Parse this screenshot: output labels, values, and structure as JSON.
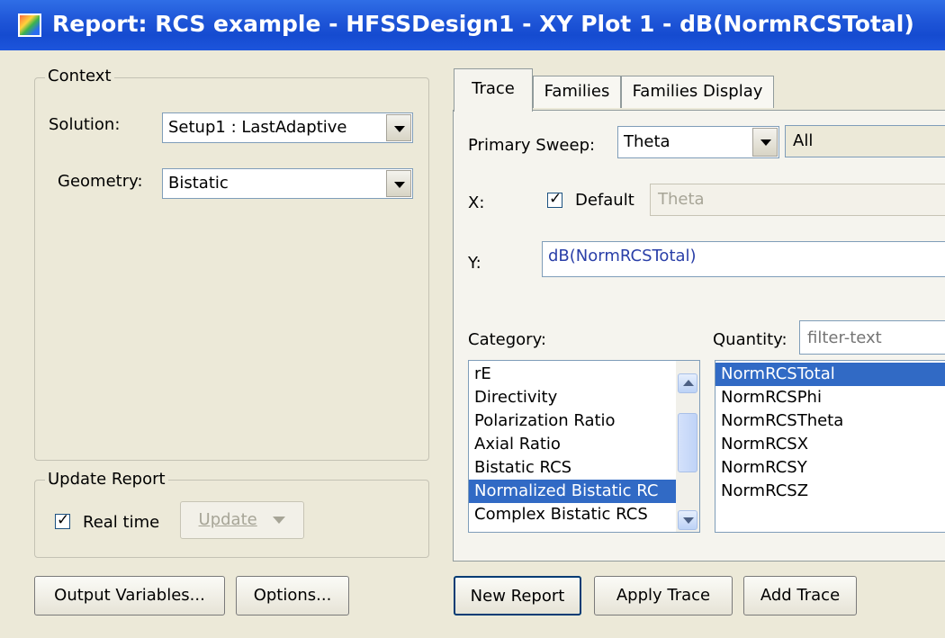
{
  "window": {
    "title": "Report: RCS example - HFSSDesign1 - XY Plot 1 - dB(NormRCSTotal)"
  },
  "context": {
    "group_label": "Context",
    "solution_label": "Solution:",
    "solution_value": "Setup1 : LastAdaptive",
    "geometry_label": "Geometry:",
    "geometry_value": "Bistatic"
  },
  "update_report": {
    "group_label": "Update Report",
    "realtime_label": "Real time",
    "realtime_checked": true,
    "update_button": "Update"
  },
  "tabs": [
    {
      "label": "Trace"
    },
    {
      "label": "Families"
    },
    {
      "label": "Families Display"
    }
  ],
  "trace": {
    "primary_sweep_label": "Primary Sweep:",
    "primary_sweep_value": "Theta",
    "primary_sweep_range": "All",
    "x_label": "X:",
    "x_default_label": "Default",
    "x_default_checked": true,
    "x_value": "Theta",
    "y_label": "Y:",
    "y_value": "dB(NormRCSTotal)",
    "category_label": "Category:",
    "quantity_label": "Quantity:",
    "quantity_filter_placeholder": "filter-text",
    "categories": [
      "rE",
      "Directivity",
      "Polarization Ratio",
      "Axial Ratio",
      "Bistatic RCS",
      "Normalized Bistatic RC",
      "Complex Bistatic RCS"
    ],
    "selected_category": "Normalized Bistatic RC",
    "quantities": [
      "NormRCSTotal",
      "NormRCSPhi",
      "NormRCSTheta",
      "NormRCSX",
      "NormRCSY",
      "NormRCSZ"
    ],
    "selected_quantity": "NormRCSTotal"
  },
  "buttons": {
    "output_variables": "Output Variables...",
    "options": "Options...",
    "new_report": "New Report",
    "apply_trace": "Apply Trace",
    "add_trace": "Add Trace"
  },
  "colors": {
    "title_bar": "#1f56d8",
    "selection": "#316ac5",
    "dialog_bg": "#ece9d8",
    "link_text": "#2a3fa8"
  }
}
